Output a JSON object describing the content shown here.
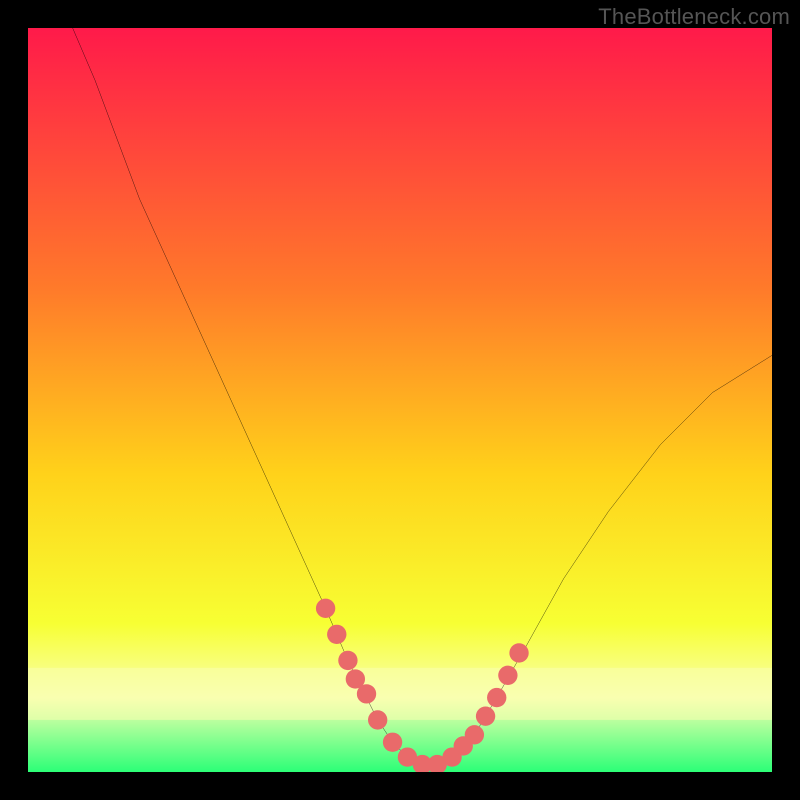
{
  "watermark": "TheBottleneck.com",
  "colors": {
    "frame": "#000000",
    "curve_stroke": "#000000",
    "dot_fill": "#e96a6a",
    "gradient_top": "#ff1a4a",
    "gradient_mid1": "#ff7a2a",
    "gradient_mid2": "#ffd21a",
    "gradient_mid3": "#f7ff33",
    "gradient_band": "#f9ffb0",
    "gradient_bottom": "#2cff77"
  },
  "chart_data": {
    "type": "line",
    "title": "",
    "xlabel": "",
    "ylabel": "",
    "xlim": [
      0,
      100
    ],
    "ylim": [
      0,
      100
    ],
    "series": [
      {
        "name": "curve",
        "x": [
          6,
          9,
          12,
          15,
          20,
          25,
          30,
          35,
          40,
          43,
          45,
          47,
          49,
          51,
          53,
          55,
          57,
          60,
          63,
          67,
          72,
          78,
          85,
          92,
          100
        ],
        "y": [
          100,
          93,
          85,
          77,
          66,
          55,
          44,
          33,
          22,
          15,
          11,
          7,
          4,
          2,
          1,
          1,
          2,
          5,
          10,
          17,
          26,
          35,
          44,
          51,
          56
        ]
      }
    ],
    "dots": {
      "name": "highlight-dots",
      "x": [
        40,
        41.5,
        43,
        44,
        45.5,
        47,
        49,
        51,
        53,
        55,
        57,
        58.5,
        60,
        61.5,
        63,
        64.5,
        66
      ],
      "y": [
        22,
        18.5,
        15,
        12.5,
        10.5,
        7,
        4,
        2,
        1,
        1,
        2,
        3.5,
        5,
        7.5,
        10,
        13,
        16
      ]
    }
  }
}
